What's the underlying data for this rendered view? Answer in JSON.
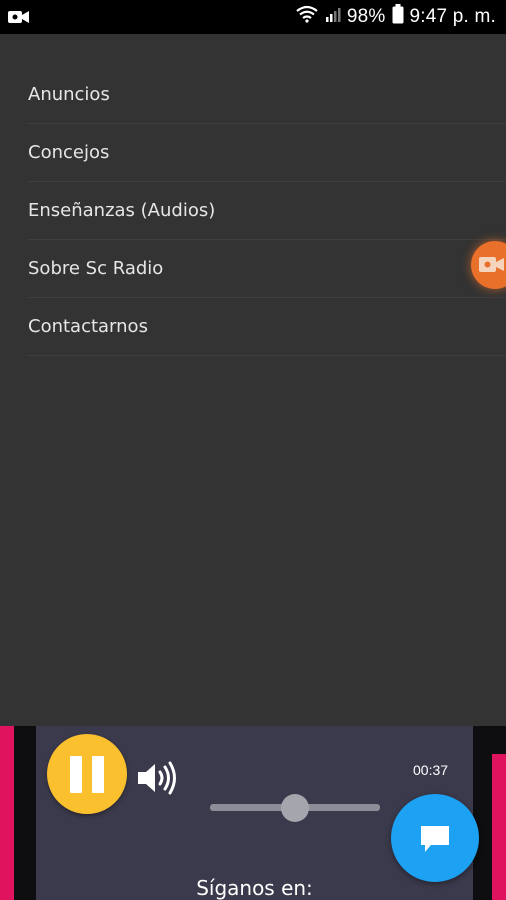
{
  "status_bar": {
    "battery_percent": "98%",
    "time": "9:47 p. m.",
    "icons": [
      "video-camera-icon",
      "wifi-icon",
      "cell-signal-icon",
      "battery-icon"
    ]
  },
  "drawer": {
    "items": [
      {
        "label": "Anuncios"
      },
      {
        "label": "Concejos"
      },
      {
        "label": "Enseñanzas (Audios)"
      },
      {
        "label": "Sobre Sc Radio"
      },
      {
        "label": "Contactarnos"
      }
    ]
  },
  "player": {
    "state": "playing",
    "elapsed": "00:37",
    "volume_level": 0.5,
    "follow_label": "Síganos en:",
    "colors": {
      "play_button": "#fbc02d",
      "accent_pink": "#e0145e",
      "chat_button": "#1da1f2",
      "video_bubble": "#e8702a"
    }
  }
}
